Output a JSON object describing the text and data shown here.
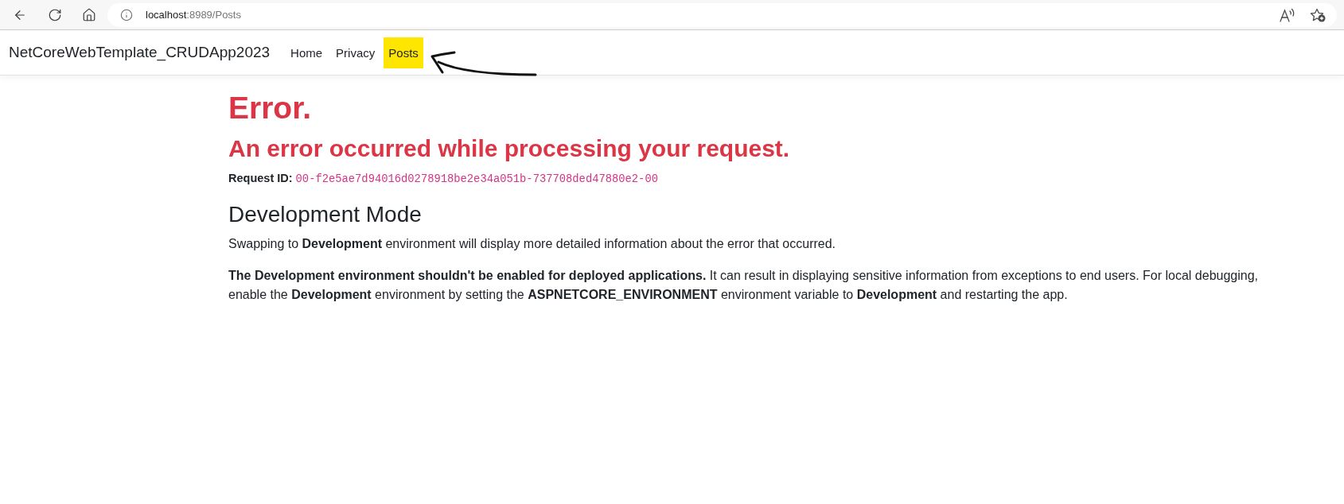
{
  "browser": {
    "url_host": "localhost",
    "url_path": ":8989/Posts"
  },
  "navbar": {
    "brand": "NetCoreWebTemplate_CRUDApp2023",
    "links": [
      {
        "label": "Home",
        "highlighted": false
      },
      {
        "label": "Privacy",
        "highlighted": false
      },
      {
        "label": "Posts",
        "highlighted": true
      }
    ],
    "annotations": [
      {
        "kind": "arrow"
      }
    ]
  },
  "error": {
    "title": "Error.",
    "message": "An error occurred while processing your request.",
    "request_id": {
      "label": "Request ID:",
      "value": "00-f2e5ae7d94016d0278918be2e34a051b-737708ded47880e2-00"
    }
  },
  "development_mode": {
    "title": "Development Mode",
    "paragraphs": [
      "Swapping to **Development** environment will display more detailed information about the error that occurred.",
      "**The Development environment shouldn't be enabled for deployed applications.** It can result in displaying sensitive information from exceptions to end users. For local debugging, enable the **Development** environment by setting the **ASPNETCORE_ENVIRONMENT** environment variable to **Development** and restarting the app."
    ]
  }
}
